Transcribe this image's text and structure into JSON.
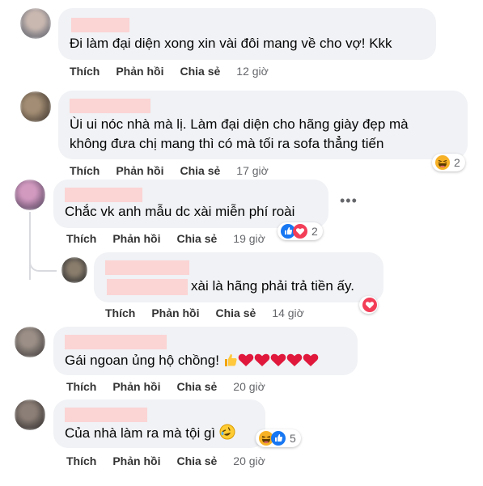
{
  "actions": {
    "like": "Thích",
    "reply": "Phản hồi",
    "share": "Chia sẻ"
  },
  "more_options": "•••",
  "comments": [
    {
      "text": "Đi làm đại diện xong xin vài đôi mang về cho vợ! Kkk",
      "time": "12 giờ"
    },
    {
      "text_line1": "Ùi ui nóc nhà mà lị. Làm đại diện cho hãng giày đẹp mà",
      "text_line2": "không đưa chị mang thì có mà tối ra sofa thẳng tiến",
      "time": "17 giờ",
      "reaction_count": "2",
      "reaction_icons": [
        "haha"
      ]
    },
    {
      "text": "Chắc vk anh mẫu dc xài miễn phí roài",
      "time": "19 giờ",
      "reaction_count": "2",
      "reaction_icons": [
        "like",
        "love"
      ]
    },
    {
      "text": "xài là hãng phải trả tiền ấy.",
      "time": "14 giờ",
      "reaction_icons": [
        "love"
      ]
    },
    {
      "text": "Gái ngoan ủng hộ chồng!",
      "time": "20 giờ",
      "emojis": [
        "thumbs-up",
        "red-heart",
        "red-heart",
        "red-heart",
        "red-heart",
        "red-heart"
      ]
    },
    {
      "text": "Của nhà làm ra mà tội gì",
      "time": "20 giờ",
      "reaction_count": "5",
      "reaction_icons": [
        "haha",
        "like"
      ],
      "emojis": [
        "rolling-laughing"
      ]
    }
  ],
  "colors": {
    "bubble": "#f0f2f5",
    "name_mask": "#fbd4d4",
    "like_blue": "#1877f2",
    "love_red": "#f33e58",
    "haha_yellow": "#f7b125",
    "meta_gray": "#65676b"
  }
}
